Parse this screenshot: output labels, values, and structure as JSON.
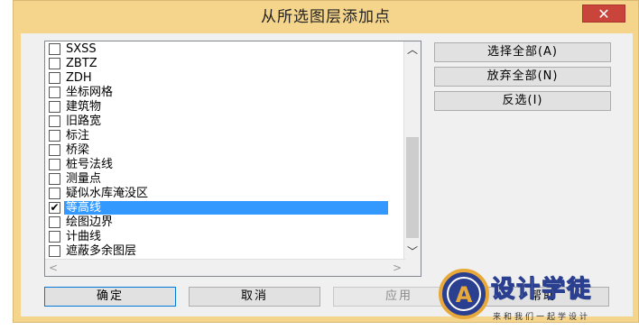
{
  "window": {
    "title": "从所选图层添加点",
    "close_glyph": "✕"
  },
  "layers": [
    {
      "label": "SXSS",
      "checked": false
    },
    {
      "label": "ZBTZ",
      "checked": false
    },
    {
      "label": "ZDH",
      "checked": false
    },
    {
      "label": "坐标网格",
      "checked": false
    },
    {
      "label": "建筑物",
      "checked": false
    },
    {
      "label": "旧路宽",
      "checked": false
    },
    {
      "label": "标注",
      "checked": false
    },
    {
      "label": "桥梁",
      "checked": false
    },
    {
      "label": "桩号法线",
      "checked": false
    },
    {
      "label": "测量点",
      "checked": false
    },
    {
      "label": "疑似水库淹没区",
      "checked": false
    },
    {
      "label": "等高线",
      "checked": true,
      "selected": true
    },
    {
      "label": "绘图边界",
      "checked": false
    },
    {
      "label": "计曲线",
      "checked": false
    },
    {
      "label": "遮蔽多余图层",
      "checked": false
    }
  ],
  "side_buttons": {
    "select_all": "选择全部(A)",
    "deselect_all": "放弃全部(N)",
    "invert": "反选(I)"
  },
  "bottom_buttons": {
    "ok": "确定",
    "cancel": "取消",
    "apply": "应用",
    "help": "帮助"
  },
  "watermark": {
    "brand": "设计学徒",
    "slogan": "来和我们一起学设计",
    "logo_letter": "A"
  },
  "colors": {
    "title_bar": "#f5d58c",
    "close": "#c9443a",
    "selection": "#3399ff"
  }
}
